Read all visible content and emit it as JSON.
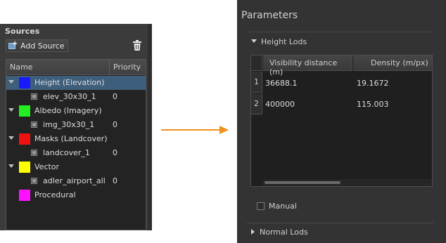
{
  "sources_panel": {
    "title": "Sources",
    "add_button_label": "Add Source",
    "columns": {
      "name": "Name",
      "priority": "Priority"
    },
    "items": [
      {
        "label": "Height (Elevation)",
        "color": "#1a1aff",
        "expanded": true,
        "selected": true,
        "child": {
          "label": "elev_30x30_1",
          "priority": "0"
        }
      },
      {
        "label": "Albedo (Imagery)",
        "color": "#22ee22",
        "expanded": true,
        "selected": false,
        "child": {
          "label": "img_30x30_1",
          "priority": "0"
        }
      },
      {
        "label": "Masks (Landcover)",
        "color": "#ee1111",
        "expanded": true,
        "selected": false,
        "child": {
          "label": "landcover_1",
          "priority": "0"
        }
      },
      {
        "label": "Vector",
        "color": "#ffff00",
        "expanded": true,
        "selected": false,
        "child": {
          "label": "adler_airport_all",
          "priority": "0"
        }
      },
      {
        "label": "Procedural",
        "color": "#ff11ff",
        "expanded": false,
        "selected": false
      }
    ]
  },
  "connector": {
    "color": "#f0901e"
  },
  "parameters_panel": {
    "title": "Parameters",
    "height_lods": {
      "label": "Height Lods",
      "expanded": true,
      "columns": [
        "Visibility distance (m)",
        "Density (m/px)"
      ],
      "rows": [
        {
          "index": "1",
          "distance": "36688.1",
          "density": "19.1672"
        },
        {
          "index": "2",
          "distance": "400000",
          "density": "115.003"
        }
      ],
      "manual_label": "Manual",
      "manual_checked": false
    },
    "normal_lods": {
      "label": "Normal Lods",
      "expanded": false
    }
  }
}
